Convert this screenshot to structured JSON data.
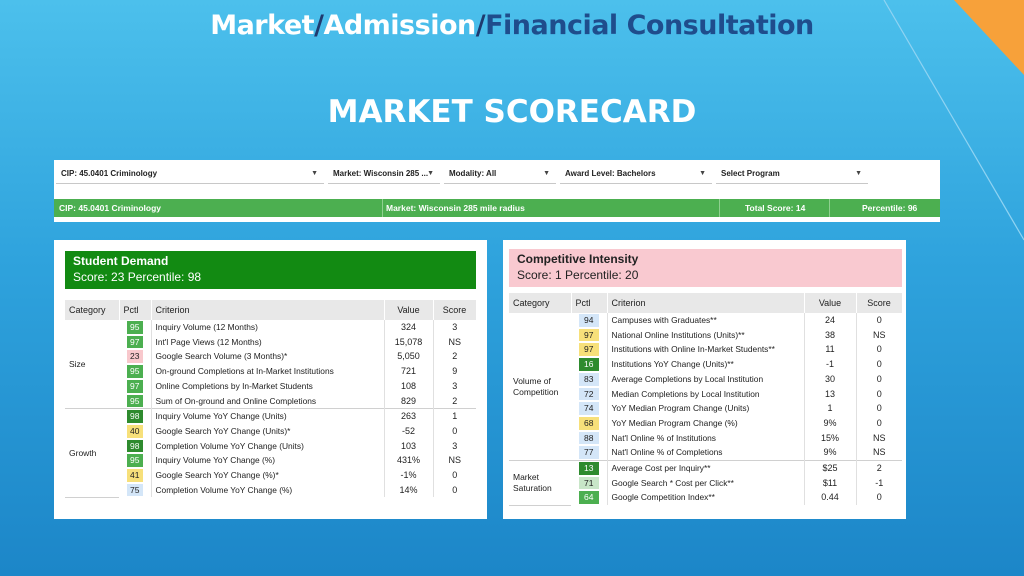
{
  "heading": {
    "part1": "Market",
    "sep": "/",
    "part2": "Admission",
    "part3": "Financial Consultation"
  },
  "subtitle": "MARKET SCORECARD",
  "filters": {
    "cip": "CIP: 45.0401 Criminology",
    "market": "Market: Wisconsin 285 ...",
    "modality": "Modality: All",
    "award": "Award Level: Bachelors",
    "program": "Select Program",
    "arrow": "▼"
  },
  "summary": {
    "cip": "CIP: 45.0401 Criminology",
    "market": "Market: Wisconsin 285 mile radius",
    "total": "Total Score: 14",
    "percentile": "Percentile: 96"
  },
  "columns": {
    "category": "Category",
    "pctl": "Pctl",
    "criterion": "Criterion",
    "value": "Value",
    "score": "Score"
  },
  "student_demand": {
    "title": "Student Demand",
    "score_line": "Score: 23  Percentile: 98",
    "groups": [
      {
        "category": "Size",
        "rows": [
          {
            "pctl": "95",
            "color": "#4caf50",
            "text": "#fff",
            "criterion": "Inquiry Volume (12 Months)",
            "value": "324",
            "score": "3"
          },
          {
            "pctl": "97",
            "color": "#4caf50",
            "text": "#fff",
            "criterion": "Int'l Page Views (12 Months)",
            "value": "15,078",
            "score": "NS"
          },
          {
            "pctl": "23",
            "color": "#f8c8cc",
            "text": "#222",
            "criterion": "Google Search Volume (3 Months)*",
            "value": "5,050",
            "score": "2"
          },
          {
            "pctl": "95",
            "color": "#4caf50",
            "text": "#fff",
            "criterion": "On-ground Completions at In-Market Institutions",
            "value": "721",
            "score": "9"
          },
          {
            "pctl": "97",
            "color": "#4caf50",
            "text": "#fff",
            "criterion": "Online Completions by In-Market Students",
            "value": "108",
            "score": "3"
          },
          {
            "pctl": "95",
            "color": "#4caf50",
            "text": "#fff",
            "criterion": "Sum of On-ground and Online Completions",
            "value": "829",
            "score": "2"
          }
        ]
      },
      {
        "category": "Growth",
        "rows": [
          {
            "pctl": "98",
            "color": "#2e8b2e",
            "text": "#fff",
            "criterion": "Inquiry Volume YoY Change (Units)",
            "value": "263",
            "score": "1"
          },
          {
            "pctl": "40",
            "color": "#f7e07a",
            "text": "#222",
            "criterion": "Google Search YoY Change (Units)*",
            "value": "-52",
            "score": "0"
          },
          {
            "pctl": "98",
            "color": "#2e8b2e",
            "text": "#fff",
            "criterion": "Completion Volume YoY Change (Units)",
            "value": "103",
            "score": "3"
          },
          {
            "pctl": "95",
            "color": "#4caf50",
            "text": "#fff",
            "criterion": "Inquiry Volume YoY Change (%)",
            "value": "431%",
            "score": "NS"
          },
          {
            "pctl": "41",
            "color": "#f7e07a",
            "text": "#222",
            "criterion": "Google Search YoY Change (%)*",
            "value": "-1%",
            "score": "0"
          },
          {
            "pctl": "75",
            "color": "#d4e6f8",
            "text": "#222",
            "criterion": "Completion Volume YoY Change (%)",
            "value": "14%",
            "score": "0"
          }
        ]
      }
    ]
  },
  "competitive_intensity": {
    "title": "Competitive Intensity",
    "score_line": "Score: 1  Percentile: 20",
    "groups": [
      {
        "category": "Volume of Competition",
        "rows": [
          {
            "pctl": "94",
            "color": "#d4e6f8",
            "text": "#222",
            "criterion": "Campuses with Graduates**",
            "value": "24",
            "score": "0"
          },
          {
            "pctl": "97",
            "color": "#f7e07a",
            "text": "#222",
            "criterion": "National Online Institutions (Units)**",
            "value": "38",
            "score": "NS"
          },
          {
            "pctl": "97",
            "color": "#f7e07a",
            "text": "#222",
            "criterion": "Institutions with Online In-Market Students**",
            "value": "11",
            "score": "0"
          },
          {
            "pctl": "16",
            "color": "#2e8b2e",
            "text": "#fff",
            "criterion": "Institutions YoY Change (Units)**",
            "value": "-1",
            "score": "0"
          },
          {
            "pctl": "83",
            "color": "#d4e6f8",
            "text": "#222",
            "criterion": "Average Completions by Local Institution",
            "value": "30",
            "score": "0"
          },
          {
            "pctl": "72",
            "color": "#d4e6f8",
            "text": "#222",
            "criterion": "Median Completions by Local Institution",
            "value": "13",
            "score": "0"
          },
          {
            "pctl": "74",
            "color": "#d4e6f8",
            "text": "#222",
            "criterion": "YoY Median Program Change (Units)",
            "value": "1",
            "score": "0"
          },
          {
            "pctl": "68",
            "color": "#f7e07a",
            "text": "#222",
            "criterion": "YoY Median Program Change (%)",
            "value": "9%",
            "score": "0"
          },
          {
            "pctl": "88",
            "color": "#d4e6f8",
            "text": "#222",
            "criterion": "Nat'l Online % of Institutions",
            "value": "15%",
            "score": "NS"
          },
          {
            "pctl": "77",
            "color": "#d4e6f8",
            "text": "#222",
            "criterion": "Nat'l Online % of Completions",
            "value": "9%",
            "score": "NS"
          }
        ]
      },
      {
        "category": "Market Saturation",
        "rows": [
          {
            "pctl": "13",
            "color": "#2e8b2e",
            "text": "#fff",
            "criterion": "Average Cost per Inquiry**",
            "value": "$25",
            "score": "2"
          },
          {
            "pctl": "71",
            "color": "#c8e6c8",
            "text": "#222",
            "criterion": "Google Search * Cost per Click**",
            "value": "$11",
            "score": "-1"
          },
          {
            "pctl": "64",
            "color": "#4caf50",
            "text": "#fff",
            "criterion": "Google Competition Index**",
            "value": "0.44",
            "score": "0"
          }
        ]
      }
    ]
  },
  "colors": {
    "green": "#4caf50",
    "dark_green": "#128a12",
    "pink": "#f9c9d0"
  }
}
